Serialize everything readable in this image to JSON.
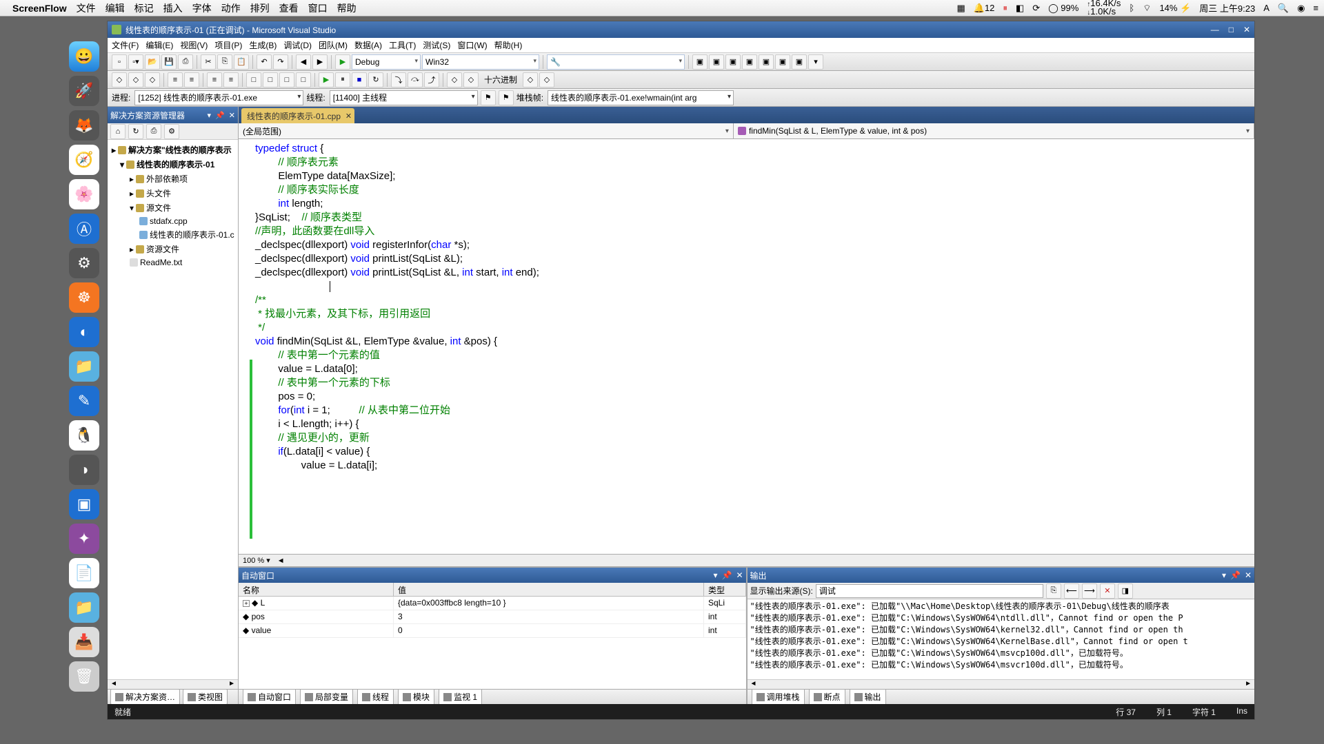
{
  "mac": {
    "app": "ScreenFlow",
    "menus": [
      "文件",
      "编辑",
      "标记",
      "插入",
      "字体",
      "动作",
      "排列",
      "查看",
      "窗口",
      "帮助"
    ],
    "right": {
      "notif": "12",
      "battery": "99%",
      "net": "16.4K/s",
      "net2": "1.0K/s",
      "wifi": "14%",
      "date": "周三 上午9:23"
    }
  },
  "vs": {
    "title": "线性表的顺序表示-01 (正在调试) - Microsoft Visual Studio",
    "menus": [
      "文件(F)",
      "编辑(E)",
      "视图(V)",
      "项目(P)",
      "生成(B)",
      "调试(D)",
      "团队(M)",
      "数据(A)",
      "工具(T)",
      "测试(S)",
      "窗口(W)",
      "帮助(H)"
    ],
    "toolbar": {
      "config": "Debug",
      "platform": "Win32"
    },
    "toolbar2": {
      "hex": "十六进制"
    },
    "debugbar": {
      "process_label": "进程:",
      "process": "[1252] 线性表的顺序表示-01.exe",
      "thread_label": "线程:",
      "thread": "[11400] 主线程",
      "stack_label": "堆栈帧:",
      "stack": "线性表的顺序表示-01.exe!wmain(int arg"
    },
    "explorer": {
      "title": "解决方案资源管理器",
      "root": "解决方案\"线性表的顺序表示",
      "project": "线性表的顺序表示-01",
      "ext": "外部依赖项",
      "hdr": "头文件",
      "src": "源文件",
      "files": [
        "stdafx.cpp",
        "线性表的顺序表示-01.c"
      ],
      "res": "资源文件",
      "readme": "ReadMe.txt",
      "btabs": [
        "解决方案资…",
        "类视图"
      ]
    },
    "editor": {
      "tab": "线性表的顺序表示-01.cpp",
      "scope_left": "(全局范围)",
      "scope_right": "findMin(SqList & L, ElemType & value, int & pos)",
      "zoom": "100 %"
    },
    "code_lines": [
      {
        "t": "typedef struct {",
        "cls": "k"
      },
      {
        "t": "        // 顺序表元素",
        "cls": "c"
      },
      {
        "t": "        ElemType data[MaxSize];",
        "cls": ""
      },
      {
        "t": "        // 顺序表实际长度",
        "cls": "c"
      },
      {
        "t": "        int length;",
        "cls": ""
      },
      {
        "t": "}SqList;    // 顺序表类型",
        "cls": "mix"
      },
      {
        "t": "",
        "cls": ""
      },
      {
        "t": "",
        "cls": ""
      },
      {
        "t": "//声明，此函数要在dll导入",
        "cls": "c"
      },
      {
        "t": "_declspec(dllexport) void registerInfor(char *s);",
        "cls": "d"
      },
      {
        "t": "_declspec(dllexport) void printList(SqList &L);",
        "cls": "d"
      },
      {
        "t": "_declspec(dllexport) void printList(SqList &L, int start, int end);",
        "cls": "d"
      },
      {
        "t": "",
        "cls": ""
      },
      {
        "t": "",
        "cls": ""
      },
      {
        "t": "/**",
        "cls": "c"
      },
      {
        "t": " * 找最小元素，及其下标，用引用返回",
        "cls": "c"
      },
      {
        "t": " */",
        "cls": "c"
      },
      {
        "t": "void findMin(SqList &L, ElemType &value, int &pos) {",
        "cls": "d"
      },
      {
        "t": "        // 表中第一个元素的值",
        "cls": "c"
      },
      {
        "t": "        value = L.data[0];",
        "cls": ""
      },
      {
        "t": "        // 表中第一个元素的下标",
        "cls": "c"
      },
      {
        "t": "        pos = 0;",
        "cls": ""
      },
      {
        "t": "        for(int i = 1;          // 从表中第二位开始",
        "cls": "mix2"
      },
      {
        "t": "        i < L.length; i++) {",
        "cls": ""
      },
      {
        "t": "        // 遇见更小的，更新",
        "cls": "c"
      },
      {
        "t": "        if(L.data[i] < value) {",
        "cls": "if"
      },
      {
        "t": "                value = L.data[i];",
        "cls": ""
      }
    ],
    "autos": {
      "title": "自动窗口",
      "cols": [
        "名称",
        "值",
        "类型"
      ],
      "rows": [
        {
          "n": "L",
          "v": "{data=0x003ffbc8 length=10 }",
          "t": "SqLi",
          "exp": "+"
        },
        {
          "n": "pos",
          "v": "3",
          "t": "int"
        },
        {
          "n": "value",
          "v": "0",
          "t": "int"
        }
      ],
      "tabs": [
        "局部变量",
        "线程",
        "模块",
        "监视 1"
      ]
    },
    "output": {
      "title": "输出",
      "src_label": "显示输出来源(S):",
      "src": "调试",
      "lines": [
        "\"线性表的顺序表示-01.exe\": 已加载\"\\\\Mac\\Home\\Desktop\\线性表的顺序表示-01\\Debug\\线性表的顺序表",
        "\"线性表的顺序表示-01.exe\": 已加载\"C:\\Windows\\SysWOW64\\ntdll.dll\"，Cannot find or open the P",
        "\"线性表的顺序表示-01.exe\": 已加载\"C:\\Windows\\SysWOW64\\kernel32.dll\"，Cannot find or open th",
        "\"线性表的顺序表示-01.exe\": 已加载\"C:\\Windows\\SysWOW64\\KernelBase.dll\"，Cannot find or open t",
        "\"线性表的顺序表示-01.exe\": 已加载\"C:\\Windows\\SysWOW64\\msvcp100d.dll\"，已加载符号。",
        "\"线性表的顺序表示-01.exe\": 已加载\"C:\\Windows\\SysWOW64\\msvcr100d.dll\"，已加载符号。"
      ],
      "tabs": [
        "调用堆栈",
        "断点",
        "输出"
      ]
    },
    "status": {
      "ready": "就绪",
      "line": "行 37",
      "col": "列 1",
      "char": "字符 1",
      "ins": "Ins"
    }
  }
}
